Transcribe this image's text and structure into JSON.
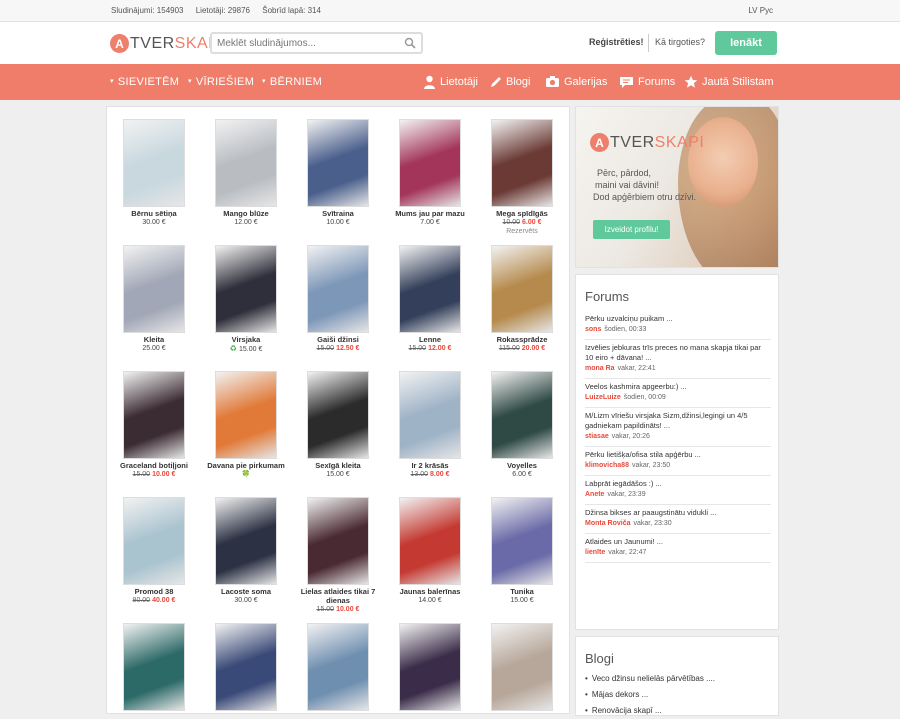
{
  "stats": {
    "ads": "Sludinājumi: 154903",
    "users": "Lietotāji: 29876",
    "today": "Šobrīd lapā: 314"
  },
  "lang": "LV Рус",
  "logo": {
    "letter": "A",
    "text_dark": "TVER",
    "text_pink": "SKAPI"
  },
  "search": {
    "placeholder": "Meklēt sludinājumos..."
  },
  "header": {
    "register": "Reģistrēties!",
    "how_to_trade": "Kā tirgoties?",
    "login": "Ienākt"
  },
  "nav": {
    "categories": [
      "SIEVIETĒM",
      "VĪRIEŠIEM",
      "BĒRNIEM"
    ],
    "links": [
      {
        "label": "Lietotāji",
        "icon": "user-icon"
      },
      {
        "label": "Blogi",
        "icon": "pencil-icon"
      },
      {
        "label": "Galerijas",
        "icon": "camera-icon"
      },
      {
        "label": "Forums",
        "icon": "chat-icon"
      },
      {
        "label": "Jautā Stilistam",
        "icon": "star-icon"
      }
    ]
  },
  "products": [
    {
      "name": "Bērnu sētiņa",
      "price": "30.00 €",
      "color": "#c9d8df"
    },
    {
      "name": "Mango blūze",
      "price": "12.00 €",
      "color": "#b9bdc2"
    },
    {
      "name": "Svītraina",
      "price": "10.00 €",
      "color": "#4a5f8c"
    },
    {
      "name": "Mums jau par mazu",
      "price": "7.00 €",
      "color": "#a3345a"
    },
    {
      "name": "Mega spīdīgās",
      "old_price": "10.00",
      "new_price": "6.00 €",
      "status": "Rezervēts",
      "color": "#6b3a35"
    },
    {
      "name": "Kleita",
      "price": "25.00 €",
      "color": "#a1a7b6"
    },
    {
      "name": "Virsjaka",
      "price": "15.00 €",
      "recycle": true,
      "color": "#2f2f3b"
    },
    {
      "name": "Gaiši džinsi",
      "old_price": "15.00",
      "new_price": "12.50 €",
      "color": "#7d97b8"
    },
    {
      "name": "Lenne",
      "old_price": "15.00",
      "new_price": "12.00 €",
      "color": "#34405b"
    },
    {
      "name": "Rokassprādze",
      "old_price": "115.00",
      "new_price": "20.00 €",
      "color": "#b58a4c"
    },
    {
      "name": "Graceland botiļjoni",
      "old_price": "15.00",
      "new_price": "10.00 €",
      "color": "#3b2b33"
    },
    {
      "name": "Davana pie pirkumam",
      "badge": "🍀",
      "color": "#e17a39"
    },
    {
      "name": "Sexīgā kleita",
      "price": "15.00 €",
      "color": "#2b2b2b"
    },
    {
      "name": "Ir 2 krāsās",
      "old_price": "13.00",
      "new_price": "8.00 €",
      "color": "#9fb3c7"
    },
    {
      "name": "Voyelles",
      "price": "6.00 €",
      "color": "#2f4a45"
    },
    {
      "name": "Promod 38",
      "old_price": "80.00",
      "new_price": "40.00 €",
      "color": "#a9c3cf"
    },
    {
      "name": "Lacoste soma",
      "price": "30.00 €",
      "color": "#2c3244"
    },
    {
      "name": "Lielas atlaides tikai 7 dienas",
      "old_price": "15.00",
      "new_price": "10.00 €",
      "color": "#4a2a32"
    },
    {
      "name": "Jaunas balerīnas",
      "price": "14.00 €",
      "color": "#c43a32"
    },
    {
      "name": "Tunika",
      "price": "15.00 €",
      "color": "#6a6aa8"
    },
    {
      "name": "",
      "price": "",
      "color": "#2c6a68"
    },
    {
      "name": "",
      "price": "",
      "color": "#3a4a78"
    },
    {
      "name": "",
      "price": "",
      "color": "#6f8fb0"
    },
    {
      "name": "",
      "price": "",
      "color": "#3b2d4a"
    },
    {
      "name": "",
      "price": "",
      "color": "#b7a79a"
    }
  ],
  "promo": {
    "tagline_1": "Pērc, pārdod,",
    "tagline_2": "maini vai dāvini!",
    "tagline_3": "Dod apģērbiem otru dzīvi.",
    "button": "Izveidot profilu!"
  },
  "forums": {
    "title": "Forums",
    "items": [
      {
        "title": "Pērku uzvalciņu puikam ...",
        "author": "sons",
        "time": "šodien, 00:33"
      },
      {
        "title": "Izvēlies jebkuras trīs preces no mana skapja tikai par 10 eiro + dāvana! ...",
        "author": "mona Ra",
        "time": "vakar, 22:41"
      },
      {
        "title": "Veelos kashmira apgeerbu:) ...",
        "author": "LuizeLuize",
        "time": "šodien, 00:09"
      },
      {
        "title": "M/Lizm vīriešu virsjaka Sizm,džinsi,legingi un 4/5 gadniekam papildināts! ...",
        "author": "stiasae",
        "time": "vakar, 20:26"
      },
      {
        "title": "Pērku lietišķa/ofisa stila apģērbu ...",
        "author": "klimovicha88",
        "time": "vakar, 23:50"
      },
      {
        "title": "Labprāt iegādāšos :) ...",
        "author": "Anete",
        "time": "vakar, 23:39"
      },
      {
        "title": "Džinsa bikses ar paaugstinātu vidukli ...",
        "author": "Monta Roviča",
        "time": "vakar, 23:30"
      },
      {
        "title": "Atlaides un Jaunumi! ...",
        "author": "lienīte",
        "time": "vakar, 22:47"
      }
    ]
  },
  "blogs": {
    "title": "Blogi",
    "items": [
      "Veco džinsu nelielās pārvētības ....",
      "Mājas dekors ...",
      "Renovācija skapī ..."
    ]
  }
}
